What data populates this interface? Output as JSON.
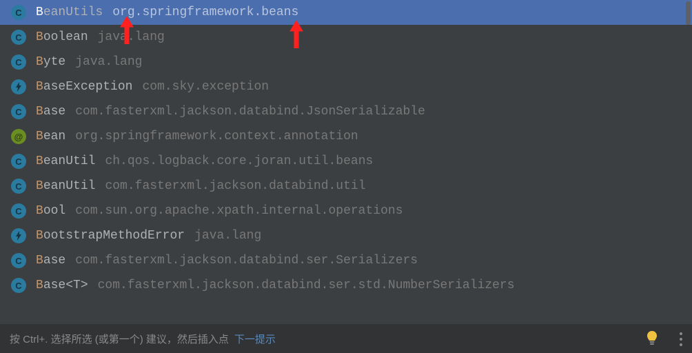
{
  "suggestions": [
    {
      "icon": "class",
      "prefix": "B",
      "rest": "eanUtils",
      "package": "org.springframework.beans",
      "selected": true
    },
    {
      "icon": "class",
      "prefix": "B",
      "rest": "oolean",
      "package": "java.lang",
      "selected": false
    },
    {
      "icon": "class",
      "prefix": "B",
      "rest": "yte",
      "package": "java.lang",
      "selected": false
    },
    {
      "icon": "lightning",
      "prefix": "B",
      "rest": "aseException",
      "package": "com.sky.exception",
      "selected": false
    },
    {
      "icon": "class",
      "prefix": "B",
      "rest": "ase",
      "package": "com.fasterxml.jackson.databind.JsonSerializable",
      "selected": false
    },
    {
      "icon": "annotation",
      "prefix": "B",
      "rest": "ean",
      "package": "org.springframework.context.annotation",
      "selected": false
    },
    {
      "icon": "class",
      "prefix": "B",
      "rest": "eanUtil",
      "package": "ch.qos.logback.core.joran.util.beans",
      "selected": false
    },
    {
      "icon": "class",
      "prefix": "B",
      "rest": "eanUtil",
      "package": "com.fasterxml.jackson.databind.util",
      "selected": false
    },
    {
      "icon": "class",
      "prefix": "B",
      "rest": "ool",
      "package": "com.sun.org.apache.xpath.internal.operations",
      "selected": false
    },
    {
      "icon": "lightning",
      "prefix": "B",
      "rest": "ootstrapMethodError",
      "package": "java.lang",
      "selected": false
    },
    {
      "icon": "class",
      "prefix": "B",
      "rest": "ase",
      "package": "com.fasterxml.jackson.databind.ser.Serializers",
      "selected": false
    },
    {
      "icon": "class",
      "prefix": "B",
      "rest": "ase<T>",
      "package": "com.fasterxml.jackson.databind.ser.std.NumberSerializers",
      "selected": false
    }
  ],
  "hintBar": {
    "text": "按 Ctrl+. 选择所选 (或第一个) 建议，然后插入点",
    "link": "下一提示"
  }
}
